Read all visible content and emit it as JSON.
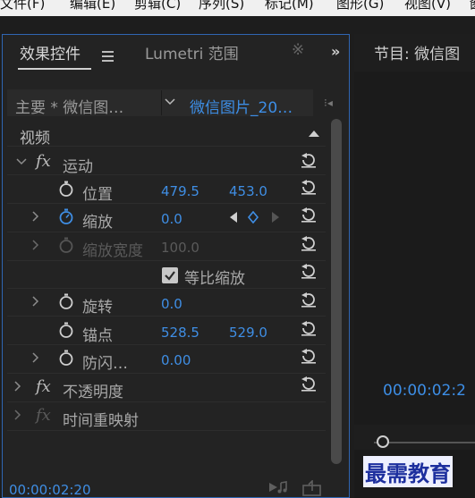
{
  "menu": [
    "文件(F)",
    "编辑(E)",
    "剪辑(C)",
    "序列(S)",
    "标记(M)",
    "图形(G)",
    "视图(V)",
    "窗"
  ],
  "tabs": {
    "effect_controls": "效果控件",
    "lumetri": "Lumetri 范围",
    "clipped": "※"
  },
  "clip_header": {
    "master": "主要 * 微信图…",
    "clip": "微信图片_20…"
  },
  "sections": {
    "video": "视频",
    "motion": "运动",
    "opacity": "不透明度",
    "time_remap": "时间重映射"
  },
  "fx_label": "fx",
  "properties": {
    "position": {
      "label": "位置",
      "x": "479.5",
      "y": "453.0"
    },
    "scale": {
      "label": "缩放",
      "value": "0.0"
    },
    "scale_width": {
      "label": "缩放宽度",
      "value": "100.0"
    },
    "uniform_scale": {
      "label": "等比缩放",
      "checked": true
    },
    "rotation": {
      "label": "旋转",
      "value": "0.0"
    },
    "anchor": {
      "label": "锚点",
      "x": "528.5",
      "y": "529.0"
    },
    "anti_flicker": {
      "label": "防闪…",
      "value": "0.00"
    }
  },
  "timecode": "00:00:02:20",
  "program": {
    "title": "节目: 微信图",
    "timecode": "00:00:02:2"
  },
  "watermark": "最需教育",
  "colors": {
    "accent_blue": "#3f8ee4",
    "panel_border": "#2f66b3"
  },
  "icons": [
    "stopwatch-icon",
    "reset-icon",
    "keyframe-icon",
    "chevron-icon",
    "checkbox-icon",
    "play-audio-icon",
    "export-frame-icon"
  ]
}
